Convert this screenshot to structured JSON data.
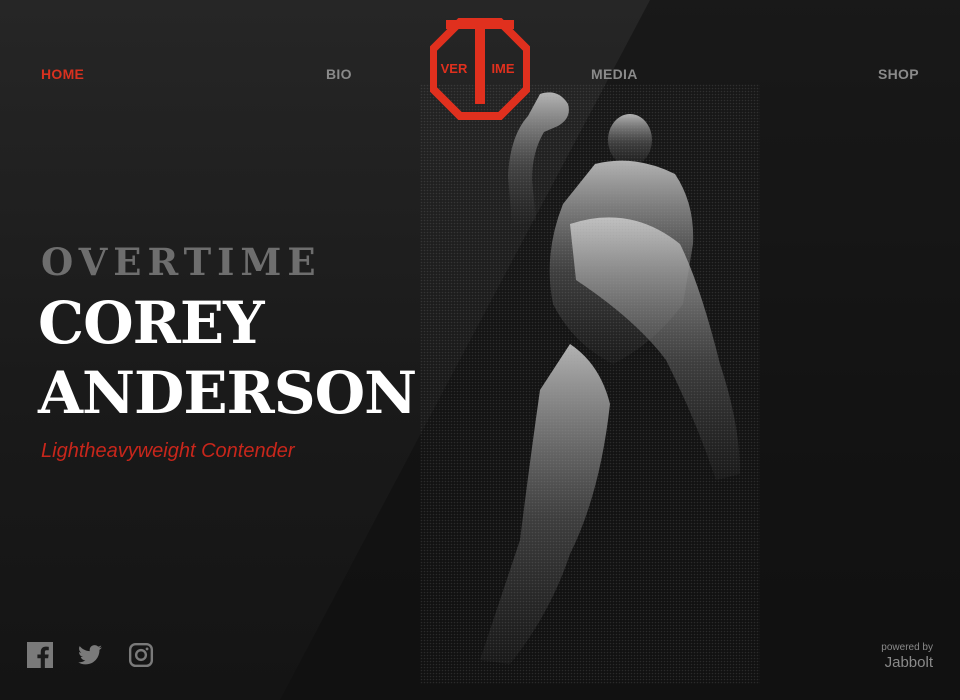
{
  "nav": {
    "items": [
      {
        "label": "HOME",
        "active": true
      },
      {
        "label": "BIO",
        "active": false
      },
      {
        "label": "MEDIA",
        "active": false
      },
      {
        "label": "SHOP",
        "active": false
      }
    ]
  },
  "logo": {
    "left": "VER",
    "right": "IME",
    "letter": "T",
    "color": "#e0301e"
  },
  "hero": {
    "kicker": "OVERTIME",
    "name_line1": "COREY",
    "name_line2": "ANDERSON",
    "subtitle": "Lightheavyweight Contender"
  },
  "social": {
    "icons": [
      "facebook-icon",
      "twitter-icon",
      "instagram-icon"
    ]
  },
  "footer": {
    "powered_by": "powered by",
    "brand": "Jabbolt"
  },
  "colors": {
    "accent": "#d9311f",
    "text": "#ffffff",
    "muted": "#8a8a8a"
  }
}
